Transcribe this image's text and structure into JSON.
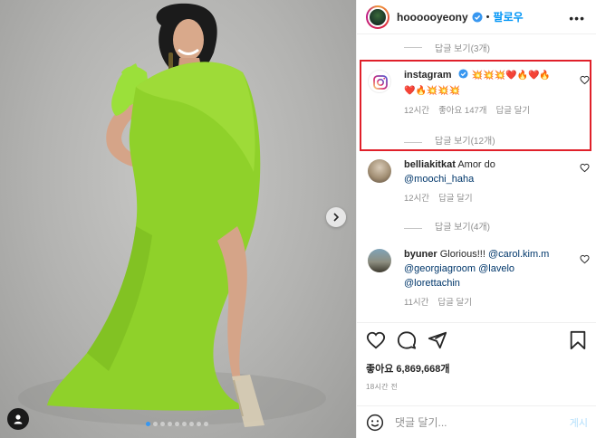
{
  "post": {
    "username": "hoooooyeony",
    "separator": "•",
    "follow_label": "팔로우",
    "more_icon": "more-horizontal-icon",
    "photo_dots": 9,
    "active_dot": 0
  },
  "comments": {
    "top_view_replies": "답글 보기(3개)",
    "items": [
      {
        "username": "instagram",
        "verified": true,
        "text_line1": "💥💥💥❤️🔥❤️🔥",
        "text_line2": "❤️🔥💥💥💥",
        "time": "12시간",
        "likes": "좋아요 147개",
        "reply": "답글 달기",
        "view_replies": "답글 보기(12개)",
        "highlighted": true
      },
      {
        "username": "belliakitkat",
        "text": "Amor do",
        "mention1": "@moochi_haha",
        "time": "12시간",
        "reply": "답글 달기",
        "view_replies": "답글 보기(4개)"
      },
      {
        "username": "byuner",
        "text": "Glorious!!!",
        "mention1": "@carol.kim.m",
        "mention2": "@georgiagroom",
        "mention3": "@lavelo",
        "mention4": "@lorettachin",
        "time": "11시간",
        "reply": "답글 달기"
      }
    ]
  },
  "actions": {
    "likes_text": "좋아요 6,869,668개",
    "post_time": "18시간 전"
  },
  "comment_box": {
    "placeholder": "댓글 달기...",
    "post_label": "게시"
  },
  "colors": {
    "accent_blue": "#0095f6",
    "highlight_red": "#e0202a",
    "dress_green": "#8fd12a"
  }
}
